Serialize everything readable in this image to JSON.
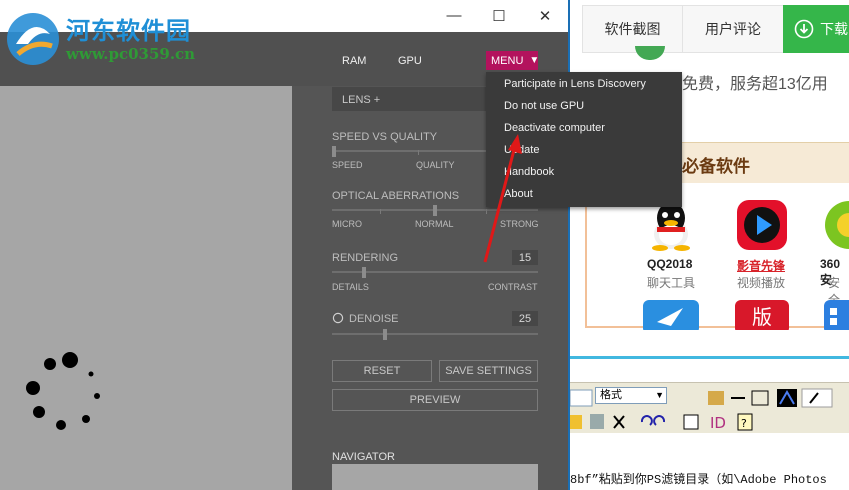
{
  "watermark": {
    "title": "河东软件园",
    "url": "www.pc0359.cn"
  },
  "window": {
    "minimize": "—",
    "maximize": "☐",
    "close": "✕"
  },
  "toolbar": {
    "ram": "RAM",
    "gpu": "GPU",
    "menu": "MENU",
    "menu_arrow": "▼"
  },
  "menu_items": [
    "Participate in Lens Discovery",
    "Do not use GPU",
    "Deactivate computer",
    "Update",
    "Handbook",
    "About"
  ],
  "lens": {
    "label": "LENS +"
  },
  "speed_quality": {
    "title": "SPEED VS QUALITY",
    "left": "SPEED",
    "mid": "QUALITY",
    "level": 0.0
  },
  "optical": {
    "title": "OPTICAL ABERRATIONS",
    "left": "MICRO",
    "mid": "NORMAL",
    "right": "STRONG",
    "level": 0.5
  },
  "rendering": {
    "title": "RENDERING",
    "value": "15",
    "left": "DETAILS",
    "right": "CONTRAST",
    "level": 0.15
  },
  "denoise": {
    "title": "DENOISE",
    "value": "25",
    "level": 0.25
  },
  "buttons": {
    "reset": "RESET",
    "save": "SAVE SETTINGS",
    "preview": "PREVIEW"
  },
  "navigator": {
    "title": "NAVIGATOR"
  },
  "site": {
    "tabs": [
      "软件截图",
      "用户评论",
      "下载"
    ],
    "free_text": "免费，服务超13亿用",
    "essentials_title": "必备软件",
    "apps": [
      {
        "name": "QQ2018",
        "category": "聊天工具"
      },
      {
        "name": "影音先锋",
        "category": "视频播放"
      },
      {
        "name": "360安",
        "category": "安全"
      }
    ]
  },
  "editor": {
    "format_value": "格式",
    "text": "8bf”粘贴到你PS滤镜目录（如\\Adobe Photos"
  },
  "colors": {
    "accent": "#b3125d",
    "download_green": "#35b64a",
    "app_bg": "#555555"
  }
}
